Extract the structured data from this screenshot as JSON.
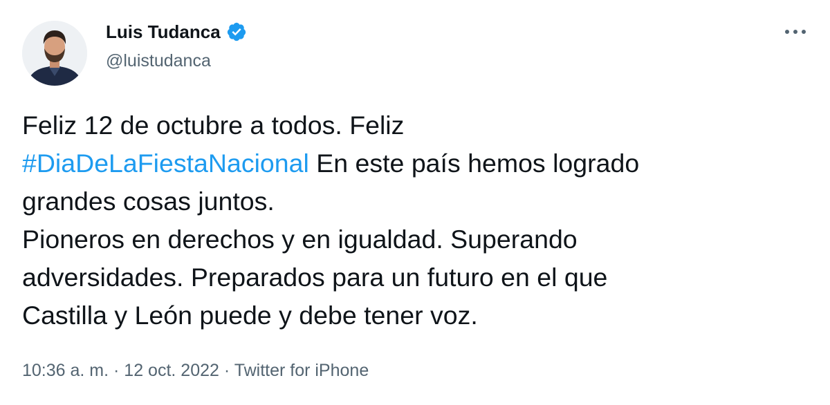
{
  "author": {
    "display_name": "Luis Tudanca",
    "handle": "@luistudanca",
    "verified": true,
    "avatar_icon": "profile-photo",
    "verified_icon": "verified-badge-icon"
  },
  "tweet": {
    "line1": "Feliz 12 de octubre a todos. Feliz",
    "hashtag": "#DiaDeLaFiestaNacional",
    "line2_rest": " En este país hemos logrado",
    "line3": "grandes cosas juntos.",
    "line4": "Pioneros en derechos y en igualdad. Superando",
    "line5": "adversidades. Preparados para un futuro en el que",
    "line6": "Castilla y León puede y debe tener voz."
  },
  "meta": {
    "time": "10:36 a. m.",
    "sep1": " · ",
    "date": "12 oct. 2022",
    "sep2": " · ",
    "source": "Twitter for iPhone"
  },
  "colors": {
    "accent": "#1d9bf0",
    "text": "#0f1419",
    "secondary": "#536471",
    "background": "#ffffff"
  },
  "icons": {
    "more": "more-horizontal-icon"
  }
}
